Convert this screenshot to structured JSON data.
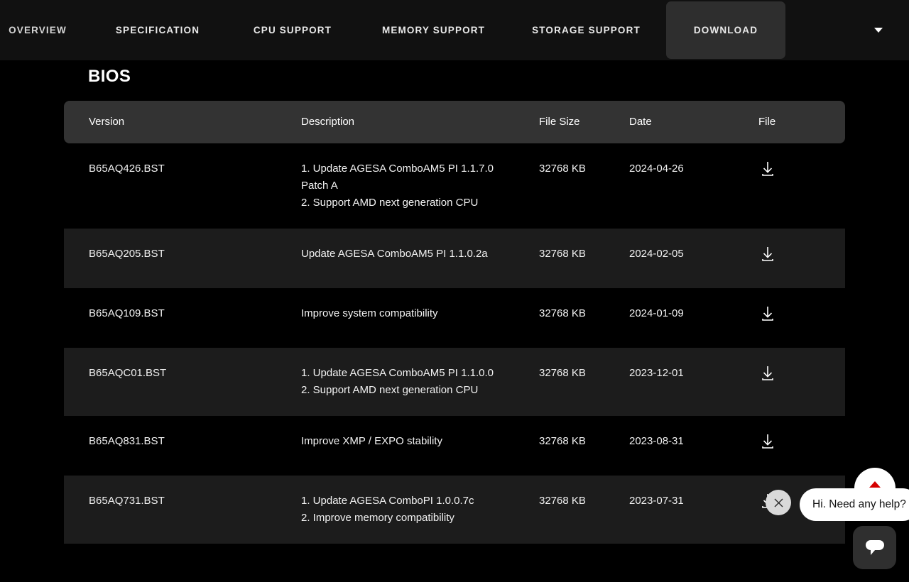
{
  "nav": {
    "tabs": [
      {
        "label": "OVERVIEW",
        "active": false
      },
      {
        "label": "SPECIFICATION",
        "active": false
      },
      {
        "label": "CPU SUPPORT",
        "active": false
      },
      {
        "label": "MEMORY SUPPORT",
        "active": false
      },
      {
        "label": "STORAGE SUPPORT",
        "active": false
      },
      {
        "label": "DOWNLOAD",
        "active": true
      }
    ],
    "more_icon": "chevron-down-icon",
    "active_tab_bg": "#2e2e2e",
    "bar_bg": "#111111"
  },
  "page": {
    "section_title": "BIOS",
    "background": "#000000"
  },
  "table": {
    "header_bg": "#333333",
    "alt_row_bg": "#1c1c1c",
    "columns": [
      "Version",
      "Description",
      "File Size",
      "Date",
      "File"
    ],
    "rows": [
      {
        "version": "B65AQ426.BST",
        "description": [
          "1. Update AGESA ComboAM5 PI 1.1.7.0",
          "Patch A",
          "2. Support AMD next generation CPU"
        ],
        "file_size": "32768 KB",
        "date": "2024-04-26",
        "file_icon": "download-icon"
      },
      {
        "version": "B65AQ205.BST",
        "description": [
          "Update AGESA ComboAM5 PI 1.1.0.2a"
        ],
        "file_size": "32768 KB",
        "date": "2024-02-05",
        "file_icon": "download-icon"
      },
      {
        "version": "B65AQ109.BST",
        "description": [
          "Improve system compatibility"
        ],
        "file_size": "32768 KB",
        "date": "2024-01-09",
        "file_icon": "download-icon"
      },
      {
        "version": "B65AQC01.BST",
        "description": [
          "1. Update AGESA ComboAM5 PI 1.1.0.0",
          "2. Support AMD next generation CPU"
        ],
        "file_size": "32768 KB",
        "date": "2023-12-01",
        "file_icon": "download-icon"
      },
      {
        "version": "B65AQ831.BST",
        "description": [
          "Improve XMP / EXPO stability"
        ],
        "file_size": "32768 KB",
        "date": "2023-08-31",
        "file_icon": "download-icon"
      },
      {
        "version": "B65AQ731.BST",
        "description": [
          "1. Update AGESA ComboPI 1.0.0.7c",
          "2. Improve memory compatibility"
        ],
        "file_size": "32768 KB",
        "date": "2023-07-31",
        "file_icon": "download-icon"
      }
    ]
  },
  "chat_widget": {
    "tooltip_text": "Hi. Need any help?",
    "close_icon": "close-icon",
    "launcher_icon": "chat-bubble-icon",
    "badge_icon": "triangle-up-icon",
    "accent_color": "#d50000",
    "launcher_bg": "#2f2f2f",
    "tooltip_bg": "#ffffff"
  }
}
